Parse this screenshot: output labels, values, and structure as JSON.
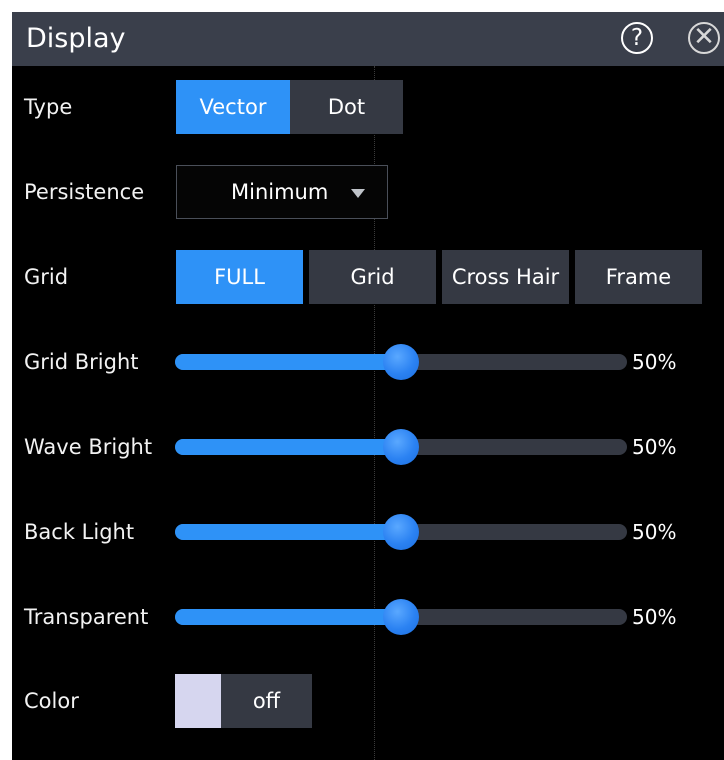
{
  "dialog": {
    "title": "Display",
    "help_icon": "question-circle-icon",
    "help_glyph": "?",
    "close_icon": "close-x-icon",
    "close_glyph": "✕"
  },
  "type": {
    "label": "Type",
    "options": [
      "Vector",
      "Dot"
    ],
    "selected": "Vector"
  },
  "persistence": {
    "label": "Persistence",
    "value": "Minimum"
  },
  "grid": {
    "label": "Grid",
    "options": [
      "FULL",
      "Grid",
      "Cross Hair",
      "Frame"
    ],
    "selected": "FULL"
  },
  "sliders": [
    {
      "label": "Grid Bright",
      "value_text": "50%",
      "fraction": 0.5
    },
    {
      "label": "Wave Bright",
      "value_text": "50%",
      "fraction": 0.5
    },
    {
      "label": "Back Light",
      "value_text": "50%",
      "fraction": 0.5
    },
    {
      "label": "Transparent",
      "value_text": "50%",
      "fraction": 0.5
    }
  ],
  "color": {
    "label": "Color",
    "swatch": "#d6d6ef",
    "toggle_text": "off"
  },
  "colors": {
    "accent": "#2e92f7",
    "button_bg": "#353943",
    "title_bar": "#3a3f4b",
    "panel_bg": "#000000"
  }
}
